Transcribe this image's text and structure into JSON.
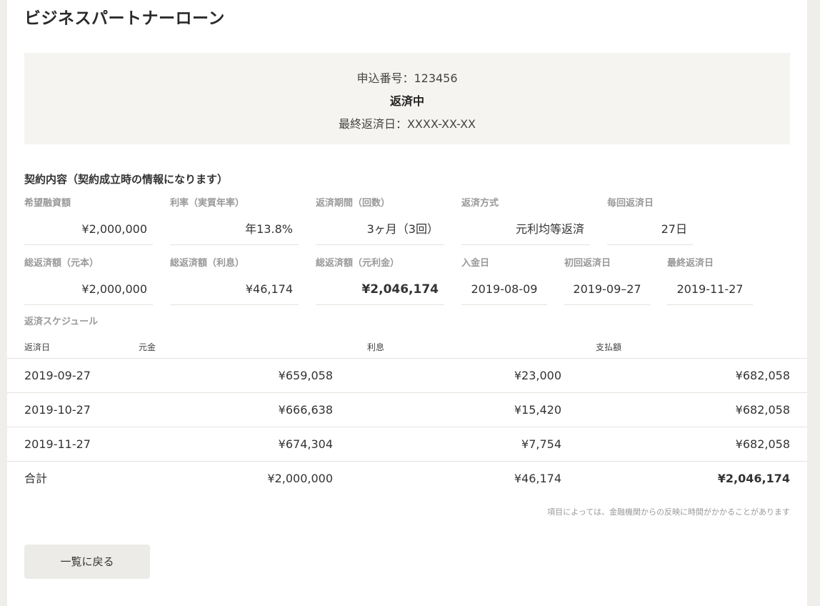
{
  "page": {
    "title": "ビジネスパートナーローン"
  },
  "status": {
    "application_number": "申込番号：123456",
    "state": "返済中",
    "final_payment_date": "最終返済日：XXXX-XX-XX"
  },
  "contract": {
    "section_title": "契約内容（契約成立時の情報になります）",
    "fields_row1": [
      {
        "label": "希望融資額",
        "value": "¥2,000,000"
      },
      {
        "label": "利率（実質年率）",
        "value": "年13.8%"
      },
      {
        "label": "返済期間（回数）",
        "value": "3ヶ月（3回）"
      },
      {
        "label": "返済方式",
        "value": "元利均等返済"
      },
      {
        "label": "毎回返済日",
        "value": "27日"
      }
    ],
    "fields_row2": [
      {
        "label": "総返済額（元本）",
        "value": "¥2,000,000"
      },
      {
        "label": "総返済額（利息）",
        "value": "¥46,174"
      },
      {
        "label": "総返済額（元利金）",
        "value": "¥2,046,174"
      },
      {
        "label": "入金日",
        "value": "2019-08-09"
      },
      {
        "label": "初回返済日",
        "value": "2019-09–27"
      },
      {
        "label": "最終返済日",
        "value": "2019-11-27"
      }
    ]
  },
  "schedule": {
    "title": "返済スケジュール",
    "headers": {
      "date": "返済日",
      "principal": "元金",
      "interest": "利息",
      "payment": "支払額"
    },
    "rows": [
      {
        "date": "2019-09-27",
        "principal": "¥659,058",
        "interest": "¥23,000",
        "payment": "¥682,058"
      },
      {
        "date": "2019-10-27",
        "principal": "¥666,638",
        "interest": "¥15,420",
        "payment": "¥682,058"
      },
      {
        "date": "2019-11-27",
        "principal": "¥674,304",
        "interest": "¥7,754",
        "payment": "¥682,058"
      }
    ],
    "total": {
      "label": "合計",
      "principal": "¥2,000,000",
      "interest": "¥46,174",
      "payment": "¥2,046,174"
    },
    "note": "項目によっては、金融機関からの反映に時間がかかることがあります"
  },
  "actions": {
    "back_label": "一覧に戻る"
  }
}
